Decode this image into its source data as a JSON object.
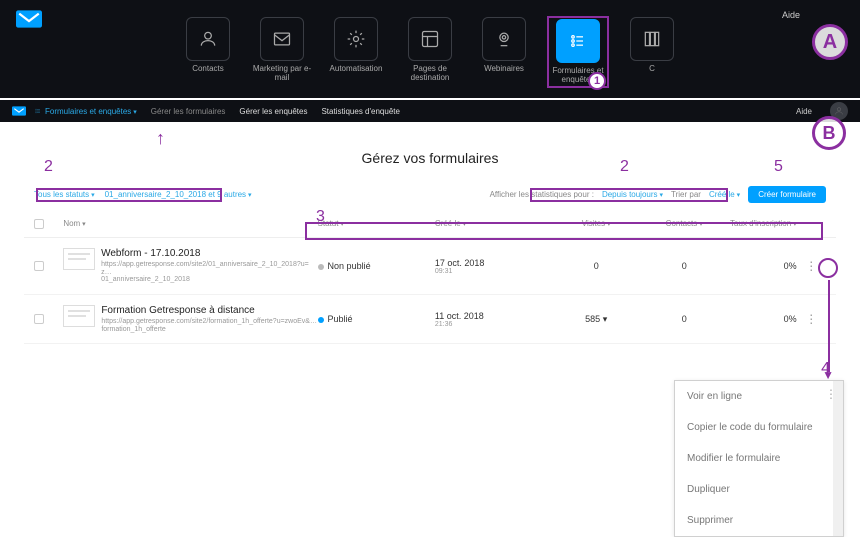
{
  "top": {
    "help": "Aide",
    "nav": [
      {
        "label": "Contacts"
      },
      {
        "label": "Marketing par e-mail"
      },
      {
        "label": "Automatisation"
      },
      {
        "label": "Pages de destination"
      },
      {
        "label": "Webinaires"
      },
      {
        "label": "Formulaires et enquêtes"
      },
      {
        "label": "C"
      }
    ]
  },
  "sub": {
    "active_menu": "Formulaires et enquêtes",
    "items": [
      "Gérer les formulaires",
      "Gérer les enquêtes",
      "Statistiques d'enquête"
    ],
    "help": "Aide"
  },
  "annotations": {
    "A": "A",
    "B": "B",
    "n1": "1",
    "n2": "2",
    "n2b": "2",
    "n3": "3",
    "n4": "4",
    "n5": "5",
    "arrow_up": "↑"
  },
  "page": {
    "title": "Gérez vos formulaires",
    "filter_statuses": "Tous les statuts",
    "filter_lists": "01_anniversaire_2_10_2018 et 9 autres",
    "stats_label": "Afficher les statistiques pour :",
    "stats_value": "Depuis toujours",
    "sort_label": "Trier par",
    "sort_value": "Créé le",
    "create_btn": "Créer formulaire"
  },
  "table": {
    "headers": {
      "name": "Nom",
      "status": "Statut",
      "created": "Créé le",
      "visits": "Visites",
      "contacts": "Contacts",
      "rate": "Taux d'inscription"
    },
    "rows": [
      {
        "title": "Webform - 17.10.2018",
        "subtitle": "https://app.getresponse.com/site2/01_anniversaire_2_10_2018?u=z…",
        "subtitle2": "01_anniversaire_2_10_2018",
        "status_text": "Non publié",
        "status_color": "gray",
        "date": "17 oct. 2018",
        "time": "09:31",
        "visits": "0",
        "contacts": "0",
        "rate": "0%"
      },
      {
        "title": "Formation Getresponse à distance",
        "subtitle": "https://app.getresponse.com/site2/formation_1h_offerte?u=zwoEv&…",
        "subtitle2": "formation_1h_offerte",
        "status_text": "Publié",
        "status_color": "blue",
        "date": "11 oct. 2018",
        "time": "21:36",
        "visits": "585 ▾",
        "contacts": "0",
        "rate": "0%"
      }
    ]
  },
  "popup": {
    "items": [
      "Voir en ligne",
      "Copier le code du formulaire",
      "Modifier le formulaire",
      "Dupliquer",
      "Supprimer"
    ]
  }
}
